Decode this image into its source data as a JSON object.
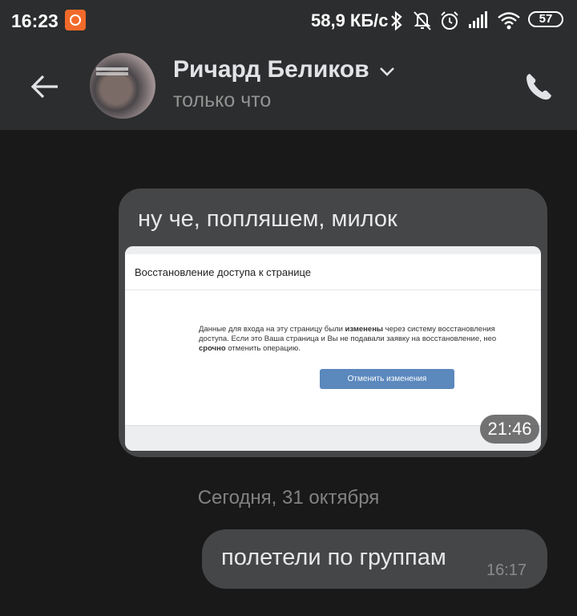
{
  "status_bar": {
    "time": "16:23",
    "speed": "58,9 КБ/с",
    "battery": "57",
    "icons": [
      "app-notification-icon",
      "bluetooth-icon",
      "mute-icon",
      "alarm-icon",
      "signal-icon",
      "wifi-icon",
      "battery-icon"
    ]
  },
  "header": {
    "name": "Ричард Беликов",
    "status": "только что"
  },
  "messages": [
    {
      "text": "ну че, попляшем, милок",
      "attachment": {
        "title": "Восстановление доступа к странице",
        "body_line1_a": "Данные для входа на эту страницу были ",
        "body_line1_bold": "изменены",
        "body_line1_b": " через систему восстановления",
        "body_line2": "доступа. Если это Ваша страница и Вы не подавали заявку на восстановление, нео",
        "body_line3_bold": "срочно",
        "body_line3_b": " отменить операцию.",
        "button": "Отменить изменения"
      },
      "time": "21:46"
    }
  ],
  "date_separator": "Сегодня, 31 октября",
  "message2": {
    "text": "полетели по группам",
    "time": "16:17"
  },
  "colors": {
    "background": "#19191a",
    "header": "#2c2d2e",
    "bubble": "#454647",
    "accent_button": "#5b88bd"
  }
}
